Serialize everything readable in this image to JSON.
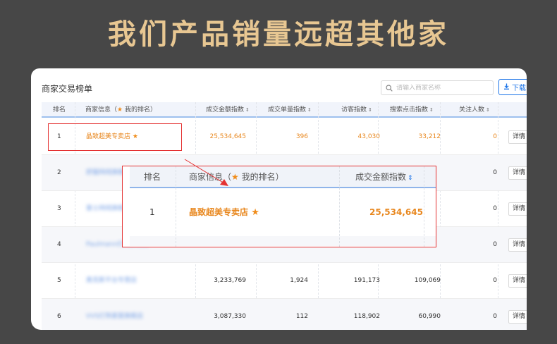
{
  "headline": "我们产品销量远超其他家",
  "panel": {
    "title": "商家交易榜单",
    "search_placeholder": "请输入商家名称",
    "download_label": "下载"
  },
  "columns": {
    "rank": "排名",
    "merchant_prefix": "商家信息（",
    "merchant_suffix": "我的排名）",
    "gmv_index": "成交金额指数",
    "order_count_index": "成交单量指数",
    "visitor_index": "访客指数",
    "search_click_index": "搜索点击指数",
    "followers": "关注人数"
  },
  "detail_label": "详情",
  "rows": [
    {
      "rank": "1",
      "merchant": "晶致超美专卖店",
      "gmv_index": "25,534,645",
      "order_count_index": "396",
      "visitor_index": "43,030",
      "search_click_index": "33,212",
      "followers": "0"
    },
    {
      "rank": "2",
      "merchant": "舒服网线旗舰店",
      "gmv_index": "",
      "order_count_index": "",
      "visitor_index": "",
      "search_click_index": "",
      "followers": "0"
    },
    {
      "rank": "3",
      "merchant": "雷士网线旗舰店",
      "gmv_index": "",
      "order_count_index": "",
      "visitor_index": "",
      "search_click_index": "",
      "followers": "0"
    },
    {
      "rank": "4",
      "merchant": "Paulmann灯具旗舰店",
      "gmv_index": "",
      "order_count_index": "",
      "visitor_index": "",
      "search_click_index": "",
      "followers": "0"
    },
    {
      "rank": "5",
      "merchant": "奥克斯平台专营店",
      "gmv_index": "3,233,769",
      "order_count_index": "1,924",
      "visitor_index": "191,173",
      "search_click_index": "109,069",
      "followers": "0"
    },
    {
      "rank": "6",
      "merchant": "VVS灯饰家居旗舰店",
      "gmv_index": "3,087,330",
      "order_count_index": "112",
      "visitor_index": "118,902",
      "search_click_index": "60,990",
      "followers": "0"
    }
  ],
  "zoom": {
    "rank_header": "排名",
    "merchant_header_prefix": "商家信息（",
    "merchant_header_suffix": "我的排名）",
    "gmv_header": "成交金额指数",
    "rank": "1",
    "merchant": "晶致超美专卖店",
    "gmv_index": "25,534,645"
  },
  "colors": {
    "background": "#474747",
    "headline": "#e8c792",
    "highlight_box": "#e43232",
    "own_store": "#e8871e",
    "accent": "#1a73e8"
  },
  "icons": [
    "search-icon",
    "download-icon",
    "star-icon",
    "sort-icon",
    "arrow-icon"
  ]
}
